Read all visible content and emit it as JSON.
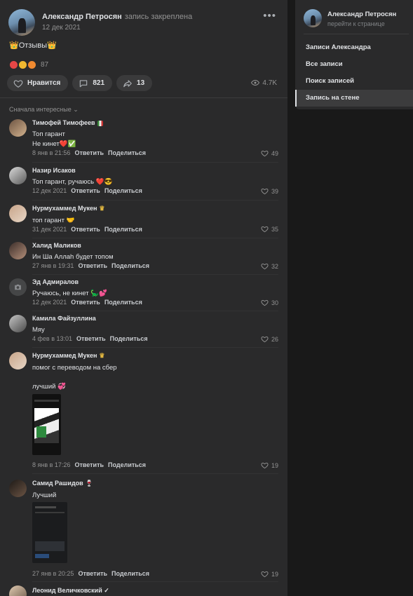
{
  "post": {
    "author": "Александр Петросян",
    "pinned_label": "запись закреплена",
    "date": "12 дек 2021",
    "text": "👑Отзывы👑",
    "reactions_count": "87",
    "like_label": "Нравится",
    "comments_count": "821",
    "shares_count": "13",
    "views": "4.7K"
  },
  "comments_sort": "Сначала интересные",
  "comments": [
    {
      "name": "Тимофей Тимофеев",
      "line1": "Топ гарант",
      "line2": "Не кинет❤️✅",
      "time": "8 янв в 21:56",
      "reply": "Ответить",
      "share": "Поделиться",
      "likes": "49"
    },
    {
      "name": "Назир Исаков",
      "line1": "Топ гарант, ручаюсь ❤️😎",
      "time": "12 дек 2021",
      "reply": "Ответить",
      "share": "Поделиться",
      "likes": "39"
    },
    {
      "name": "Нурмухаммед Мукен",
      "line1": "топ гарант 🤝",
      "time": "31 дек 2021",
      "reply": "Ответить",
      "share": "Поделиться",
      "likes": "35"
    },
    {
      "name": "Халид Маликов",
      "line1": "Ин Ша Аллаh будет топом",
      "time": "27 янв в 19:31",
      "reply": "Ответить",
      "share": "Поделиться",
      "likes": "32"
    },
    {
      "name": "Эд Адмиралов",
      "line1": "Ручаюсь, не кинет 🦕💕",
      "time": "12 дек 2021",
      "reply": "Ответить",
      "share": "Поделиться",
      "likes": "30"
    },
    {
      "name": "Камила Файзуллина",
      "line1": "Мяу",
      "time": "4 фев в 13:01",
      "reply": "Ответить",
      "share": "Поделиться",
      "likes": "26"
    },
    {
      "name": "Нурмухаммед Мукен",
      "line1": "помог с переводом на сбер",
      "line2": "лучший 💞",
      "time": "8 янв в 17:26",
      "reply": "Ответить",
      "share": "Поделиться",
      "likes": "19"
    },
    {
      "name": "Самид Рашидов",
      "line1": "Лучший",
      "time": "27 янв в 20:25",
      "reply": "Ответить",
      "share": "Поделиться",
      "likes": "19"
    },
    {
      "name": "Леонид Величковский ✓"
    }
  ],
  "sidebar": {
    "name": "Александр Петросян",
    "link": "перейти к странице",
    "items": [
      "Записи Александра",
      "Все записи",
      "Поиск записей",
      "Запись на стене"
    ]
  },
  "colors": {
    "background": "#191919",
    "panel": "#2a2a2b",
    "text": "#e1e3e6",
    "muted": "#939393"
  }
}
